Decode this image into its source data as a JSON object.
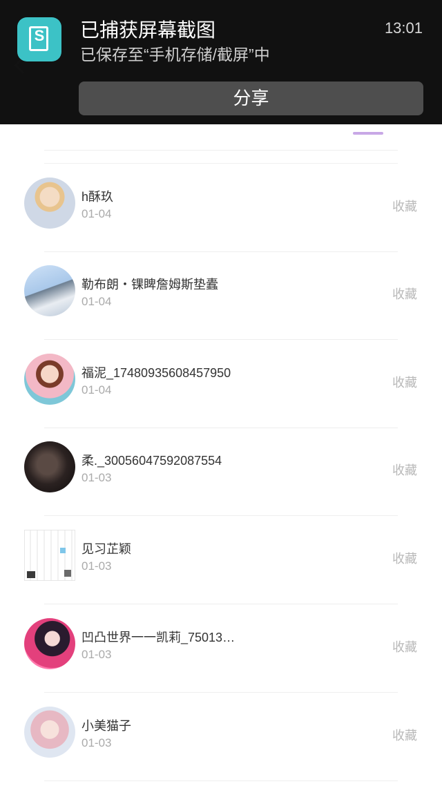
{
  "notification": {
    "title": "已捕获屏幕截图",
    "time": "13:01",
    "body": "已保存至“手机存储/截屏”中",
    "share_label": "分享",
    "app_icon": "screenshot-icon",
    "accent": "#3cc2c6"
  },
  "list": {
    "items": [
      {
        "name": "h酥玖",
        "date": "01-04",
        "action": "收藏"
      },
      {
        "name": "勒布朗・锞睥詹姆斯垫蠹",
        "date": "01-04",
        "action": "收藏"
      },
      {
        "name": "福泥_17480935608457950",
        "date": "01-04",
        "action": "收藏"
      },
      {
        "name": "柔._30056047592087554",
        "date": "01-03",
        "action": "收藏"
      },
      {
        "name": "见习芷颖",
        "date": "01-03",
        "action": "收藏"
      },
      {
        "name": "凹凸世界一一凯莉_75013…",
        "date": "01-03",
        "action": "收藏"
      },
      {
        "name": "小美猫子",
        "date": "01-03",
        "action": "收藏"
      }
    ]
  }
}
